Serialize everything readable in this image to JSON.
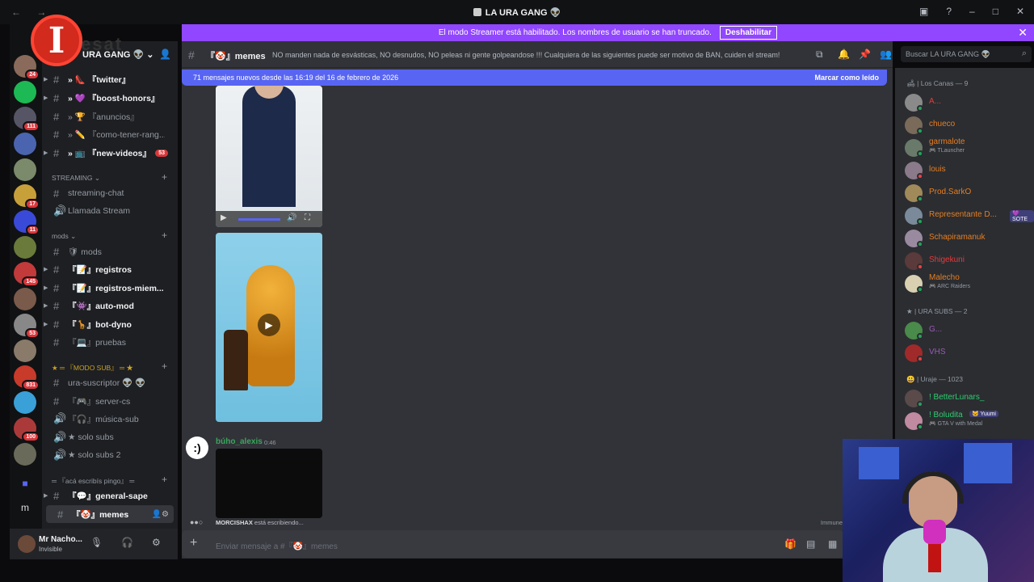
{
  "window": {
    "title": "LA URA GANG 👽",
    "nav": "← →"
  },
  "streamer_banner": {
    "text": "El modo Streamer está habilitado. Los nombres de usuario se han truncado.",
    "button": "Deshabilitar",
    "close": "✕"
  },
  "logo": {
    "letter": "I",
    "watermark": "esat"
  },
  "server": {
    "name": "URA GANG 👽",
    "chevron": "⌄"
  },
  "guild_badges": [
    "24",
    "111",
    "17",
    "11",
    "145",
    "53",
    "831",
    "100"
  ],
  "channels": [
    {
      "prefix": "» 👠",
      "name": "『twitter』",
      "unread": true
    },
    {
      "prefix": "» 💜",
      "name": "『boost-honors』",
      "unread": true
    },
    {
      "prefix": "» 🏆",
      "name": "『anuncios』",
      "unread": false
    },
    {
      "prefix": "» ✏️",
      "name": "『como-tener-rang...",
      "unread": false
    },
    {
      "prefix": "» 📺",
      "name": "『new-videos』",
      "unread": true,
      "badge": "53"
    }
  ],
  "streaming_category": "STREAMING ⌄",
  "streaming_channels": [
    {
      "icon": "#",
      "name": "streaming-chat"
    },
    {
      "icon": "🔊",
      "name": "Llamada Stream"
    }
  ],
  "mods_category": "mods ⌄",
  "mods_channels": [
    {
      "icon": "#",
      "name": "🛡 mods",
      "unread": false
    },
    {
      "icon": "#",
      "name": "『📝』registros",
      "unread": true
    },
    {
      "icon": "#",
      "name": "『📝』registros-miem...",
      "unread": true
    },
    {
      "icon": "#",
      "name": "『👾』auto-mod",
      "unread": true
    },
    {
      "icon": "#",
      "name": "『🦒』bot-dyno",
      "unread": true
    },
    {
      "icon": "#",
      "name": "『💻』pruebas",
      "unread": false
    }
  ],
  "sub_category": "★ ═ 『MODO SUB』 ═ ★",
  "sub_channels": [
    {
      "icon": "#",
      "name": "ura-suscriptor 👽 👽"
    },
    {
      "icon": "#",
      "name": "『🎮』server-cs"
    },
    {
      "icon": "🔊",
      "name": "『🎧』música-sub"
    },
    {
      "icon": "🔊",
      "name": "★ solo subs"
    },
    {
      "icon": "🔊",
      "name": "★ solo subs 2"
    }
  ],
  "chat_category": "═ 『acá escribís pingo』 ═",
  "chat_channels": [
    {
      "icon": "#",
      "name": "『💬』general-sape",
      "active": false
    },
    {
      "icon": "#",
      "name": "『🤡』memes",
      "active": true
    }
  ],
  "user": {
    "name": "Mr Nacho...",
    "status": "Invisible"
  },
  "channel_header": {
    "name": "『🤡』memes",
    "topic": "NO manden nada de esvásticas, NO desnudos, NO peleas ni gente golpeandose !!! Cualquiera de las siguientes puede ser motivo de BAN, cuiden el stream!"
  },
  "new_messages_bar": {
    "text": "71 mensajes nuevos desde las 16:19 del 16 de febrero de 2026",
    "action": "Marcar como leído"
  },
  "message": {
    "author": "búho_alexis",
    "time": "0:46",
    "avatar_glyph": ":)"
  },
  "typing": {
    "user": "MORCISHAX",
    "text": " está escribiendo..."
  },
  "immune": "Immune",
  "composer": {
    "placeholder": "Enviar mensaje a #『🤡』memes"
  },
  "search": {
    "placeholder": "Buscar LA URA GANG 👽"
  },
  "member_groups": [
    {
      "title": "🛋 | Los Canas — 9"
    },
    {
      "title": "★ | URA SUBS — 2"
    },
    {
      "title": "😃 | Uraje — 1023"
    }
  ],
  "members": [
    {
      "name": "A...",
      "color": "#e63a3a",
      "status_color": "#23a55a"
    },
    {
      "name": "chueco",
      "color": "#e67e22",
      "status_color": "#23a55a"
    },
    {
      "name": "garmalote",
      "sub": "🎮 TLauncher",
      "color": "#e67e22",
      "status_color": "#23a55a"
    },
    {
      "name": "louis",
      "color": "#e67e22",
      "status_color": "#f23f43"
    },
    {
      "name": "Prod.SarkO",
      "color": "#e67e22",
      "status_color": "#23a55a"
    },
    {
      "name": "Representante D...",
      "tag": "💜 SOTE",
      "color": "#e67e22",
      "status_color": "#23a55a"
    },
    {
      "name": "Schapiramanuk",
      "color": "#e67e22",
      "status_color": "#23a55a"
    },
    {
      "name": "Shigekuni",
      "color": "#e63a3a",
      "status_color": "#f23f43"
    },
    {
      "name": "Malecho",
      "sub": "🎮 ARC Raiders",
      "color": "#e67e22",
      "status_color": "#23a55a"
    },
    {
      "name": "G...",
      "color": "#9b59b6",
      "status_color": "#23a55a"
    },
    {
      "name": "VHS",
      "color": "#9b59b6",
      "status_color": "#f23f43"
    },
    {
      "name": "! BetterLunars_",
      "color": "#2ecc71",
      "status_color": "#23a55a"
    },
    {
      "name": "! Boludita",
      "sub": "🎮 GTA V with Medal",
      "tag": "🐱 Yuumi",
      "color": "#2ecc71",
      "status_color": "#23a55a"
    }
  ]
}
